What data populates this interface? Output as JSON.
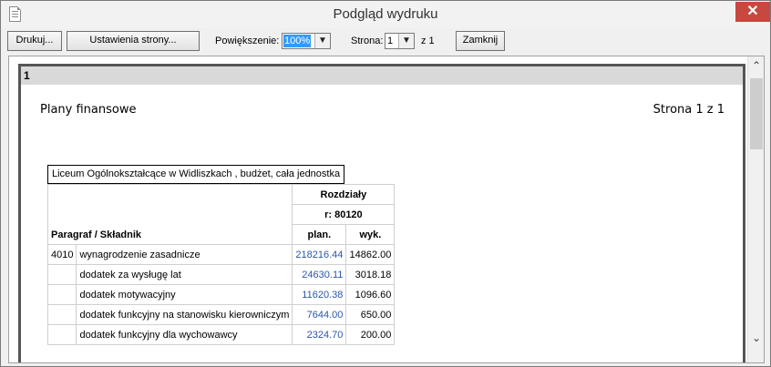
{
  "window": {
    "title": "Podgląd wydruku",
    "close_glyph": "✕"
  },
  "toolbar": {
    "print_label": "Drukuj...",
    "setup_label": "Ustawienia strony...",
    "zoom_label": "Powiększenie:",
    "zoom_value": "100%",
    "page_label": "Strona:",
    "page_value": "1",
    "page_of": "z  1",
    "close_label": "Zamknij"
  },
  "page": {
    "number": "1",
    "title": "Plany finansowe",
    "pages": "Strona 1 z 1",
    "caption": "Liceum Ogólnokształcące w Widliszkach , budżet, cała jednostka"
  },
  "table": {
    "group_header": "Rozdziały",
    "section": "r: 80120",
    "row_header": "Paragraf / Składnik",
    "col_plan": "plan.",
    "col_wyk": "wyk.",
    "rows": [
      {
        "code": "4010",
        "name": "wynagrodzenie zasadnicze",
        "plan": "218216.44",
        "wyk": "14862.00"
      },
      {
        "code": "",
        "name": "dodatek za wysługę lat",
        "plan": "24630.11",
        "wyk": "3018.18"
      },
      {
        "code": "",
        "name": "dodatek motywacyjny",
        "plan": "11620.38",
        "wyk": "1096.60"
      },
      {
        "code": "",
        "name": "dodatek funkcyjny na stanowisku kierowniczym",
        "plan": "7644.00",
        "wyk": "650.00"
      },
      {
        "code": "",
        "name": "dodatek funkcyjny dla wychowawcy",
        "plan": "2324.70",
        "wyk": "200.00"
      }
    ]
  },
  "scrollbar": {
    "up_glyph": "⌃",
    "down_glyph": "⌄"
  }
}
